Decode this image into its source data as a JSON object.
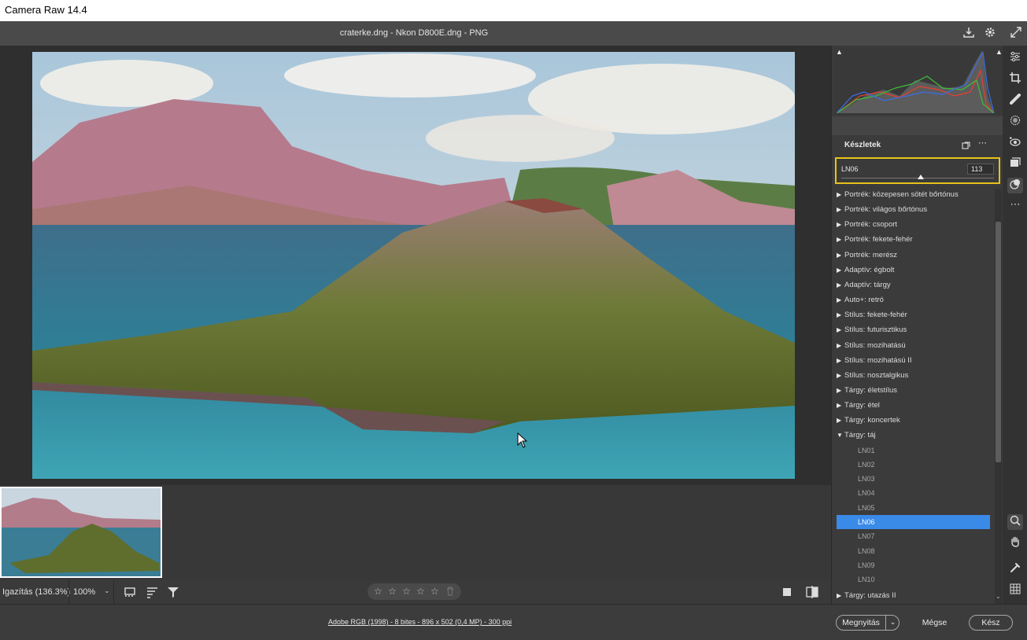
{
  "window": {
    "title": "Camera Raw 14.4"
  },
  "header": {
    "file_info": "craterke.dng - Nkon D800E.dng  -  PNG",
    "icons": [
      "save-icon",
      "gear-icon",
      "fullscreen-icon"
    ]
  },
  "right_panel": {
    "section_title": "Készletek",
    "selected_preset": {
      "name": "LN06",
      "amount": "113",
      "amount_fraction": 0.52
    },
    "presets": [
      {
        "label": "Portrék: közepesen sötét bőrtónus",
        "expanded": false
      },
      {
        "label": "Portrék: világos bőrtónus",
        "expanded": false
      },
      {
        "label": "Portrék: csoport",
        "expanded": false
      },
      {
        "label": "Portrék: fekete-fehér",
        "expanded": false
      },
      {
        "label": "Portrék: merész",
        "expanded": false
      },
      {
        "label": "Adaptív: égbolt",
        "expanded": false
      },
      {
        "label": "Adaptív: tárgy",
        "expanded": false
      },
      {
        "label": "Auto+: retró",
        "expanded": false
      },
      {
        "label": "Stílus: fekete-fehér",
        "expanded": false
      },
      {
        "label": "Stílus: futurisztikus",
        "expanded": false
      },
      {
        "label": "Stílus: mozihatású",
        "expanded": false
      },
      {
        "label": "Stílus: mozihatású II",
        "expanded": false
      },
      {
        "label": "Stílus: nosztalgikus",
        "expanded": false
      },
      {
        "label": "Tárgy: életstílus",
        "expanded": false
      },
      {
        "label": "Tárgy: étel",
        "expanded": false
      },
      {
        "label": "Tárgy: koncertek",
        "expanded": false
      },
      {
        "label": "Tárgy: táj",
        "expanded": true
      }
    ],
    "sub_presets": [
      "LN01",
      "LN02",
      "LN03",
      "LN04",
      "LN05",
      "LN06",
      "LN07",
      "LN08",
      "LN09",
      "LN10"
    ],
    "selected_sub_index": 5,
    "last_preset": "Tárgy: utazás II"
  },
  "tools": [
    "edit-sliders-icon",
    "crop-icon",
    "heal-icon",
    "mask-icon",
    "red-eye-icon",
    "snapshots-icon",
    "presets-icon",
    "more-icon"
  ],
  "bottom_tools": [
    "zoom-icon",
    "hand-icon",
    "color-sampler-icon",
    "grid-icon"
  ],
  "bottom_bar": {
    "fit_label": "Igazítás (136.3%)",
    "zoom_value": "100%",
    "rating_stars": 5,
    "rating_value": 0
  },
  "footer": {
    "workflow_link": "Adobe RGB (1998) - 8 bites - 896 x 502 (0,4 MP) - 300 ppi",
    "open_button": "Megnyitás",
    "cancel_button": "Mégse",
    "done_button": "Kész"
  },
  "colors": {
    "accent": "#3a8ae8",
    "highlight_border": "#e8c21a",
    "panel_bg": "#3b3b3b"
  }
}
